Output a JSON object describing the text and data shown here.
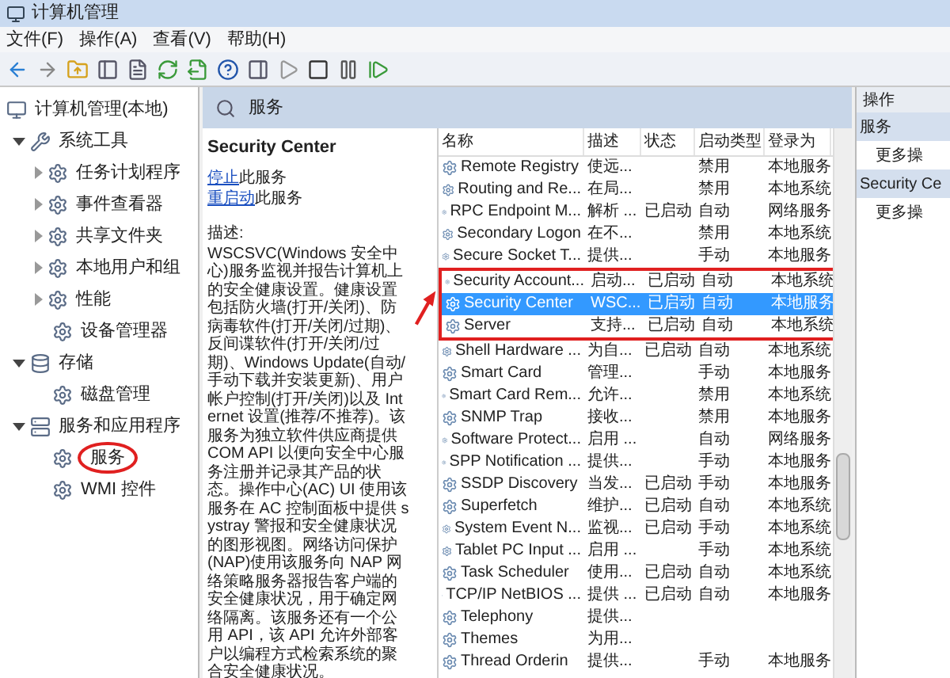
{
  "window": {
    "title": "计算机管理"
  },
  "menu": [
    "文件(F)",
    "操作(A)",
    "查看(V)",
    "帮助(H)"
  ],
  "tree": {
    "label": "计算机管理(本地)",
    "children": [
      {
        "label": "系统工具",
        "expanded": true,
        "children": [
          {
            "label": "任务计划程序",
            "expanded": false
          },
          {
            "label": "事件查看器",
            "expanded": false
          },
          {
            "label": "共享文件夹",
            "expanded": false
          },
          {
            "label": "本地用户和组",
            "expanded": false
          },
          {
            "label": "性能",
            "expanded": false
          },
          {
            "label": "设备管理器"
          }
        ]
      },
      {
        "label": "存储",
        "expanded": true,
        "children": [
          {
            "label": "磁盘管理"
          }
        ]
      },
      {
        "label": "服务和应用程序",
        "expanded": true,
        "children": [
          {
            "label": "服务",
            "circled": true
          },
          {
            "label": "WMI 控件",
            "circled": false
          }
        ]
      }
    ]
  },
  "pane_header": "服务",
  "detail": {
    "title": "Security Center",
    "links": [
      {
        "link": "停止",
        "rest": "此服务"
      },
      {
        "link": "重启动",
        "rest": "此服务"
      }
    ],
    "description_label": "描述:",
    "description": "WSCSVC(Windows 安全中心)服务监视并报告计算机上的安全健康设置。健康设置包括防火墙(打开/关闭)、防病毒软件(打开/关闭/过期)、反间谍软件(打开/关闭/过期)、Windows Update(自动/手动下载并安装更新)、用户帐户控制(打开/关闭)以及 Internet 设置(推荐/不推荐)。该服务为独立软件供应商提供 COM API 以便向安全中心服务注册并记录其产品的状态。操作中心(AC) UI 使用该服务在 AC 控制面板中提供 systray 警报和安全健康状况的图形视图。网络访问保护(NAP)使用该服务向 NAP 网络策略服务器报告客户端的安全健康状况，用于确定网络隔离。该服务还有一个公用 API，该 API 允许外部客户以编程方式检索系统的聚合安全健康状况。"
  },
  "table": {
    "columns": [
      "名称",
      "描述",
      "状态",
      "启动类型",
      "登录为"
    ],
    "rows": [
      {
        "cells": [
          "Remote Registry",
          "使远...",
          "",
          "禁用",
          "本地服务"
        ],
        "selected": false
      },
      {
        "cells": [
          "Routing and Re...",
          "在局...",
          "",
          "禁用",
          "本地系统"
        ],
        "selected": false
      },
      {
        "cells": [
          "RPC Endpoint M...",
          "解析 ...",
          "已启动",
          "自动",
          "网络服务"
        ],
        "selected": false
      },
      {
        "cells": [
          "Secondary Logon",
          "在不...",
          "",
          "禁用",
          "本地系统"
        ],
        "selected": false
      },
      {
        "cells": [
          "Secure Socket T...",
          "提供...",
          "",
          "手动",
          "本地服务"
        ],
        "selected": false
      },
      {
        "cells": [
          "Security Account...",
          "启动...",
          "已启动",
          "自动",
          "本地系统"
        ],
        "selected": false
      },
      {
        "cells": [
          "Security Center",
          "WSC...",
          "已启动",
          "自动",
          "本地服务"
        ],
        "selected": true
      },
      {
        "cells": [
          "Server",
          "支持...",
          "已启动",
          "自动",
          "本地系统"
        ],
        "selected": false
      },
      {
        "cells": [
          "Shell Hardware ...",
          "为自...",
          "已启动",
          "自动",
          "本地系统"
        ],
        "selected": false
      },
      {
        "cells": [
          "Smart Card",
          "管理...",
          "",
          "手动",
          "本地服务"
        ],
        "selected": false
      },
      {
        "cells": [
          "Smart Card Rem...",
          "允许...",
          "",
          "禁用",
          "本地系统"
        ],
        "selected": false
      },
      {
        "cells": [
          "SNMP Trap",
          "接收...",
          "",
          "禁用",
          "本地服务"
        ],
        "selected": false
      },
      {
        "cells": [
          "Software Protect...",
          "启用 ...",
          "",
          "自动",
          "网络服务"
        ],
        "selected": false
      },
      {
        "cells": [
          "SPP Notification ...",
          "提供...",
          "",
          "手动",
          "本地服务"
        ],
        "selected": false
      },
      {
        "cells": [
          "SSDP Discovery",
          "当发...",
          "已启动",
          "手动",
          "本地服务"
        ],
        "selected": false
      },
      {
        "cells": [
          "Superfetch",
          "维护...",
          "已启动",
          "自动",
          "本地系统"
        ],
        "selected": false
      },
      {
        "cells": [
          "System Event N...",
          "监视...",
          "已启动",
          "手动",
          "本地系统"
        ],
        "selected": false
      },
      {
        "cells": [
          "Tablet PC Input ...",
          "启用 ...",
          "",
          "手动",
          "本地系统"
        ],
        "selected": false
      },
      {
        "cells": [
          "Task Scheduler",
          "使用...",
          "已启动",
          "自动",
          "本地系统"
        ],
        "selected": false
      },
      {
        "cells": [
          "TCP/IP NetBIOS ...",
          "提供 ...",
          "已启动",
          "自动",
          "本地服务"
        ],
        "selected": false
      },
      {
        "cells": [
          "Telephony",
          "提供...",
          "",
          "",
          ""
        ],
        "selected": false
      },
      {
        "cells": [
          "Themes",
          "为用...",
          "",
          "",
          ""
        ],
        "selected": false
      },
      {
        "cells": [
          "Thread Orderin",
          "提供...",
          "",
          "手动",
          "本地服务"
        ],
        "selected": false
      }
    ]
  },
  "actions": {
    "title": "操作",
    "sections": [
      {
        "heading": "服务",
        "item": "更多操"
      },
      {
        "heading": "Security Ce",
        "item": "更多操"
      }
    ]
  }
}
